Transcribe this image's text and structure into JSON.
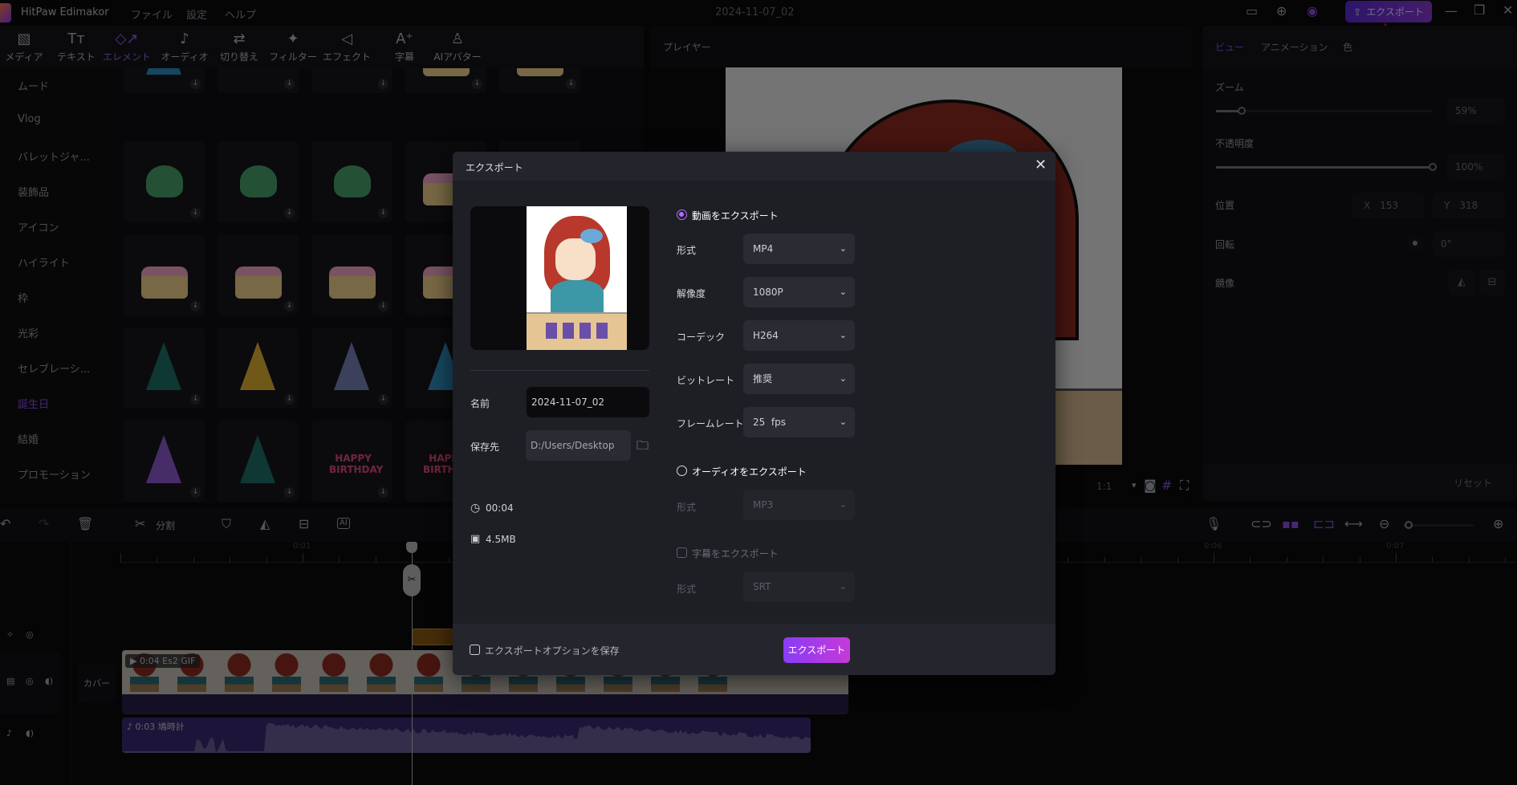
{
  "app": {
    "name": "HitPaw Edimakor",
    "menus": [
      "ファイル",
      "設定",
      "ヘルプ"
    ],
    "project_title": "2024-11-07_02",
    "export_label": "エクスポート",
    "accent": "#8a39d4"
  },
  "toolbar": [
    {
      "label": "メディア",
      "icon": "media-icon"
    },
    {
      "label": "テキスト",
      "icon": "text-icon"
    },
    {
      "label": "エレメント",
      "icon": "element-icon",
      "active": true
    },
    {
      "label": "オーディオ",
      "icon": "audio-icon"
    },
    {
      "label": "切り替え",
      "icon": "transition-icon"
    },
    {
      "label": "フィルター",
      "icon": "filter-icon"
    },
    {
      "label": "エフェクト",
      "icon": "effect-icon"
    },
    {
      "label": "字幕",
      "icon": "subtitle-icon"
    },
    {
      "label": "AIアバター",
      "icon": "ai-avatar-icon"
    }
  ],
  "categories": [
    "ムード",
    "Vlog",
    "バレットジャ...",
    "装飾品",
    "アイコン",
    "ハイライト",
    "枠",
    "光彩",
    "セレブレーシ...",
    "誕生日",
    "結婚",
    "プロモーション"
  ],
  "active_category": "誕生日",
  "player": {
    "title": "プレイヤー",
    "ratio": "1:1"
  },
  "right_panel": {
    "tabs": [
      "ビュー",
      "アニメーション",
      "色"
    ],
    "zoom_label": "ズーム",
    "zoom_value": "59%",
    "zoom_level": 0.12,
    "opacity_label": "不透明度",
    "opacity_value": "100%",
    "opacity_level": 1.0,
    "position_label": "位置",
    "x_label": "X",
    "x_value": "153",
    "y_label": "Y",
    "y_value": "318",
    "rotation_label": "回転",
    "rotation_value": "0°",
    "mirror_label": "鏡像",
    "reset_label": "リセット"
  },
  "timeline": {
    "split_label": "分割",
    "ticks": [
      "0:01",
      "0:06",
      "0:07"
    ],
    "cover_label": "カバー",
    "video_clip": "0:04 Es2 GIF",
    "audio_clip": "0:03 鳩時計"
  },
  "dialog": {
    "title": "エクスポート",
    "name_label": "名前",
    "name_value": "2024-11-07_02",
    "save_label": "保存先",
    "save_value": "D:/Users/Desktop",
    "duration": "00:04",
    "size": "4.5MB",
    "video_export": "動画をエクスポート",
    "format_label": "形式",
    "format": "MP4",
    "resolution_label": "解像度",
    "resolution": "1080P",
    "codec_label": "コーデック",
    "codec": "H264",
    "bitrate_label": "ビットレート",
    "bitrate": "推奨",
    "framerate_label": "フレームレート",
    "framerate": "25  fps",
    "audio_export": "オーディオをエクスポート",
    "audio_format_label": "形式",
    "audio_format": "MP3",
    "subtitle_export": "字幕をエクスポート",
    "subtitle_format_label": "形式",
    "subtitle_format": "SRT",
    "save_options": "エクスポートオプションを保存",
    "export_button": "エクスポート"
  }
}
